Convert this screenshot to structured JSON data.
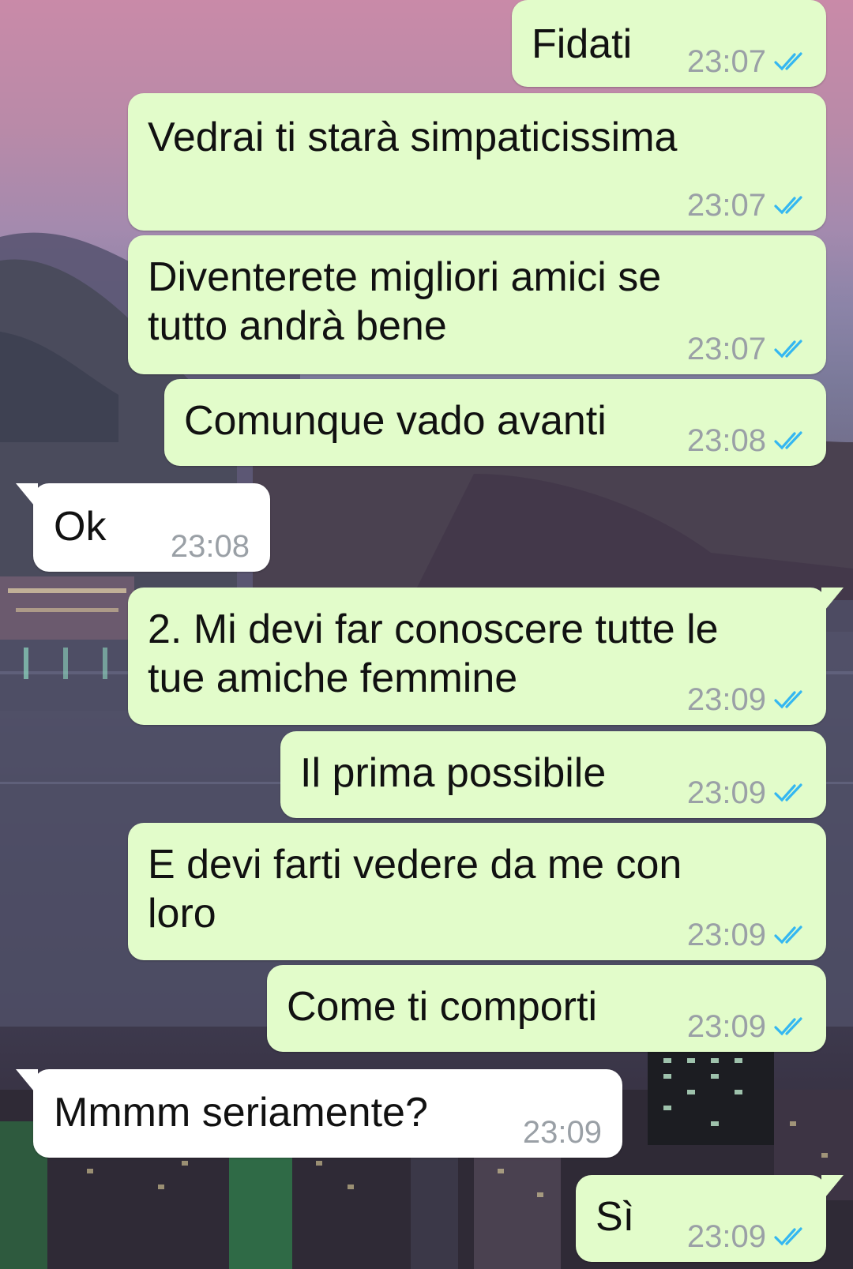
{
  "chat": {
    "messages": [
      {
        "direction": "out",
        "text": "Fidati",
        "time": "23:07",
        "status_icon": "double-check-read-icon"
      },
      {
        "direction": "out",
        "text": "Vedrai ti starà simpaticissima",
        "time": "23:07",
        "status_icon": "double-check-read-icon"
      },
      {
        "direction": "out",
        "text": "Diventerete migliori amici se\ntutto andrà bene",
        "time": "23:07",
        "status_icon": "double-check-read-icon"
      },
      {
        "direction": "out",
        "text": "Comunque vado avanti",
        "time": "23:08",
        "status_icon": "double-check-read-icon"
      },
      {
        "direction": "in",
        "text": "Ok",
        "time": "23:08"
      },
      {
        "direction": "out",
        "text": "2. Mi devi far conoscere tutte le\ntue amiche femmine",
        "time": "23:09",
        "status_icon": "double-check-read-icon"
      },
      {
        "direction": "out",
        "text": "Il prima possibile",
        "time": "23:09",
        "status_icon": "double-check-read-icon"
      },
      {
        "direction": "out",
        "text": "E devi farti vedere da me con\nloro",
        "time": "23:09",
        "status_icon": "double-check-read-icon"
      },
      {
        "direction": "out",
        "text": "Come ti comporti",
        "time": "23:09",
        "status_icon": "double-check-read-icon"
      },
      {
        "direction": "in",
        "text": "Mmmm seriamente?",
        "time": "23:09"
      },
      {
        "direction": "out",
        "text": "Sì",
        "time": "23:09",
        "status_icon": "double-check-read-icon"
      }
    ]
  },
  "colors": {
    "outgoing_bubble": "#e2fcca",
    "incoming_bubble": "#ffffff",
    "timestamp": "#9aa0a6",
    "read_ticks": "#34b7f1"
  }
}
